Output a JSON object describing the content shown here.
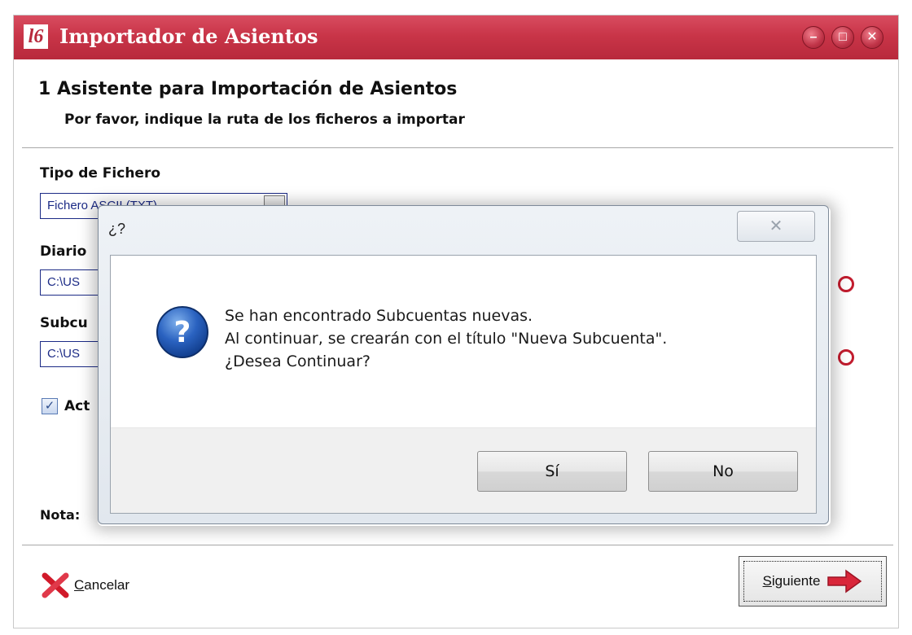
{
  "window": {
    "app_logo": "l6",
    "title": "Importador de Asientos",
    "controls": {
      "minimize": "–",
      "maximize": "□",
      "close": "✕"
    }
  },
  "wizard": {
    "step_title": "1 Asistente para Importación de Asientos",
    "step_subtitle": "Por favor, indique la ruta de los ficheros a importar",
    "tipo_label": "Tipo de Fichero",
    "tipo_value": "Fichero ASCII (TXT)",
    "diario_label": "Diario",
    "diario_value": "C:\\US",
    "subcuentas_label": "Subcu",
    "subcuentas_value": "C:\\US",
    "checkbox_label": "Act",
    "checkbox_checked": true,
    "note_label": "Nota:",
    "cancel_label": "Cancelar",
    "next_label": "Siguiente"
  },
  "dialog": {
    "title": "¿?",
    "close_glyph": "✕",
    "message_lines": [
      "Se han encontrado Subcuentas nuevas.",
      "Al continuar, se crearán con el título \"Nueva Subcuenta\".",
      "¿Desea Continuar?"
    ],
    "yes_label": "Sí",
    "no_label": "No",
    "icon": "question-icon"
  },
  "colors": {
    "titlebar": "#c93548",
    "field_border": "#1c2b86",
    "accent_red": "#c21c2e"
  }
}
